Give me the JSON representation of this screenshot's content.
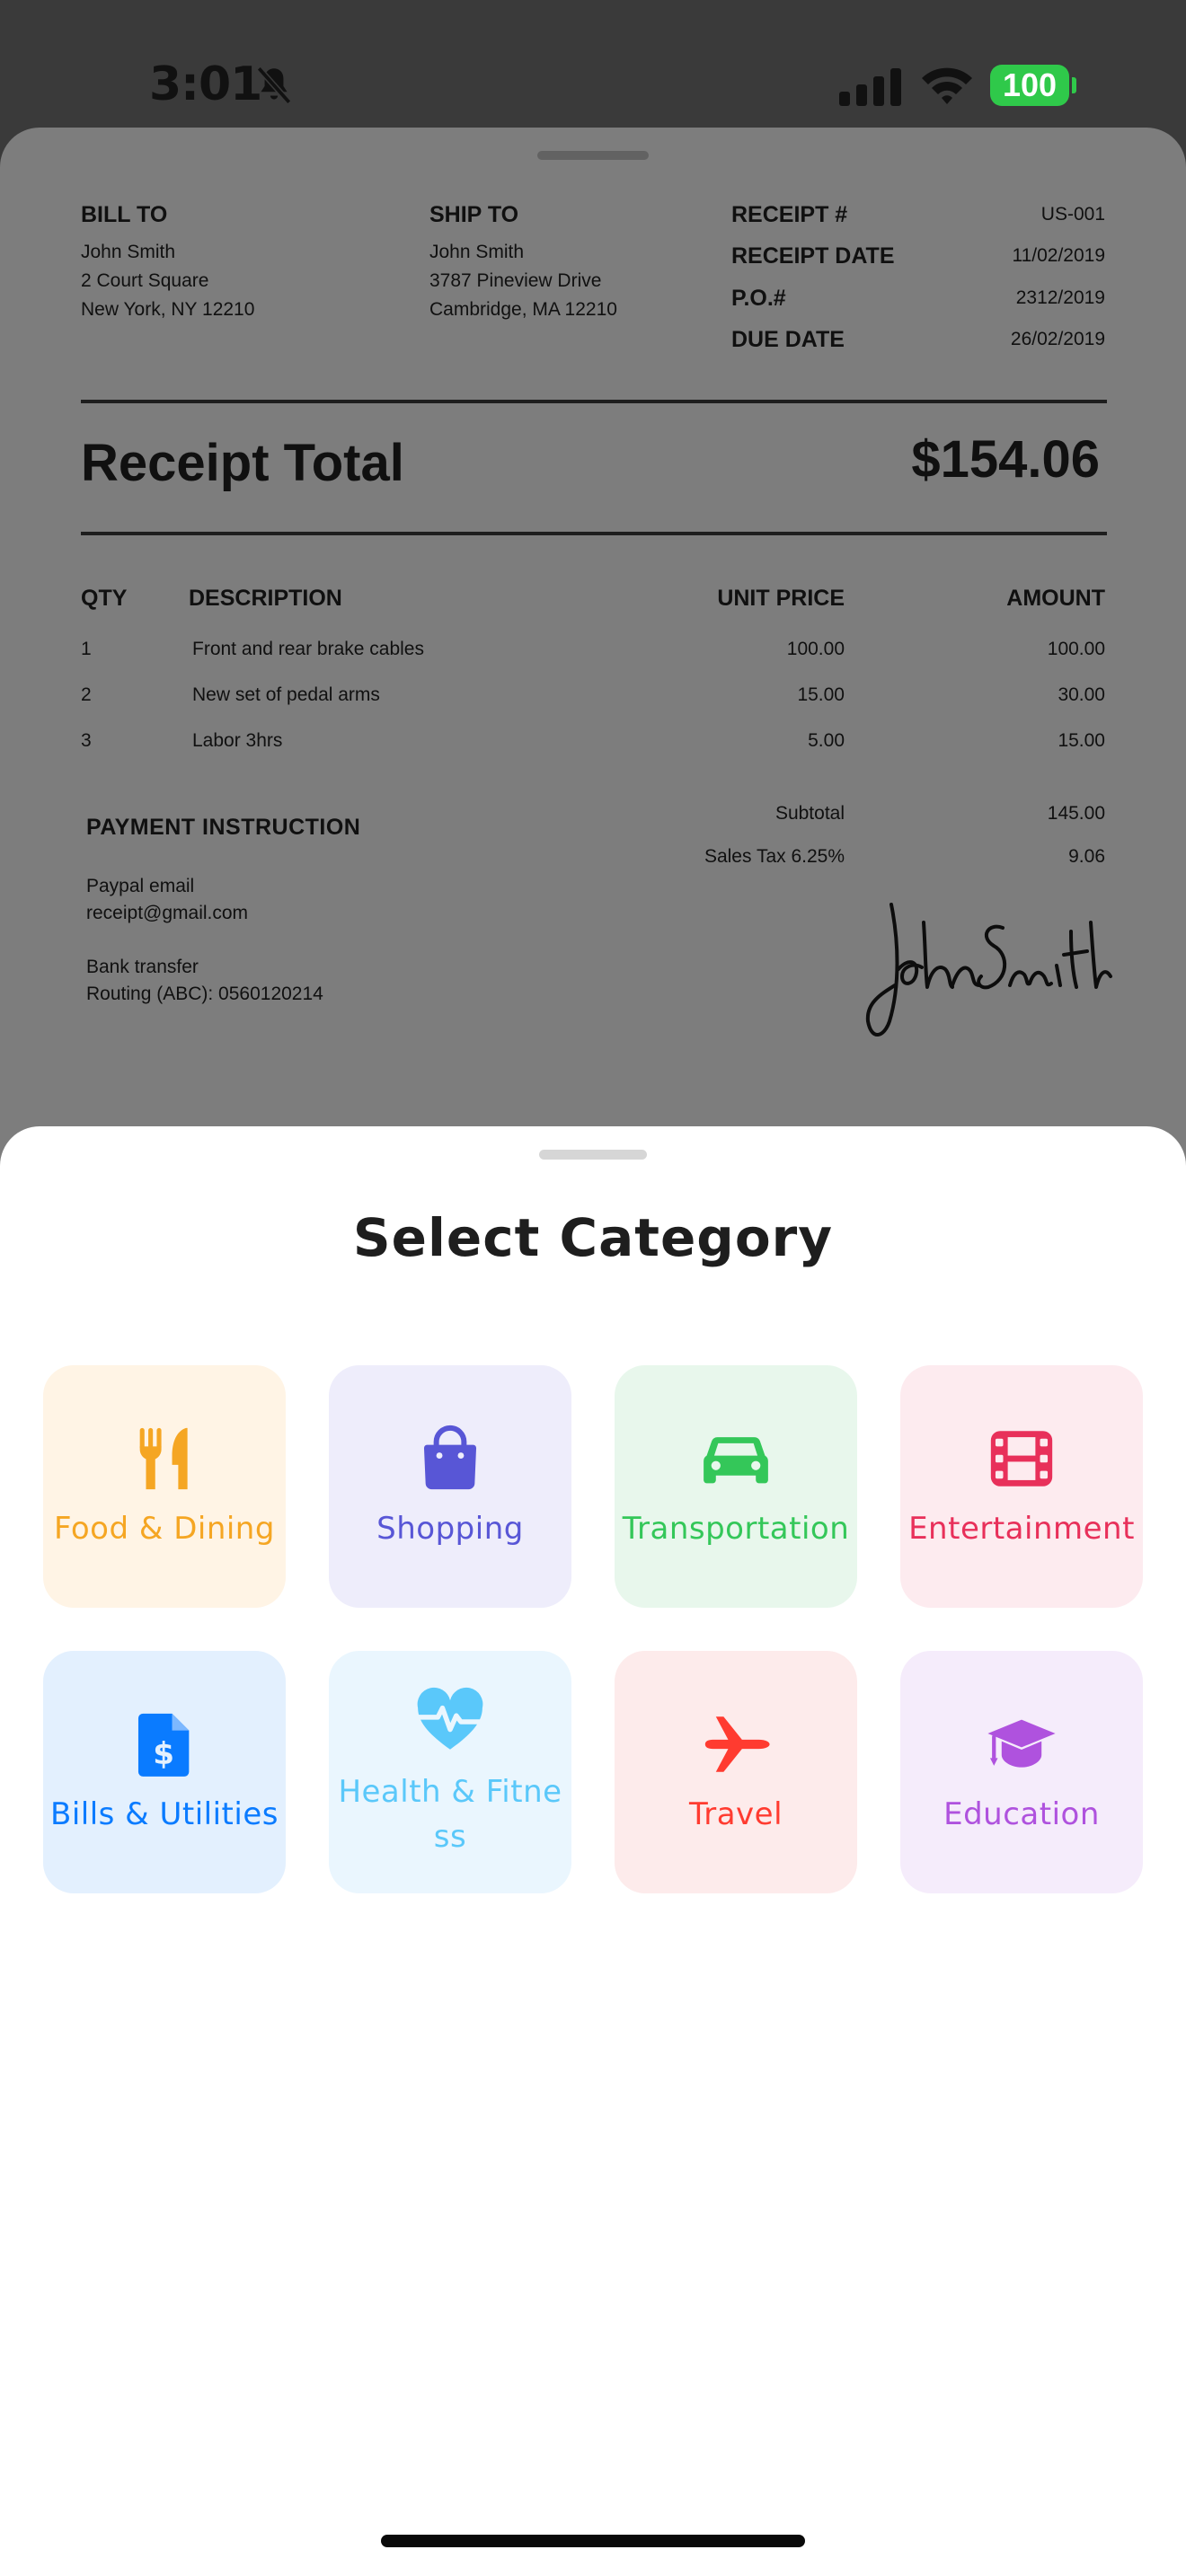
{
  "status_bar": {
    "time": "3:01",
    "battery": "100",
    "icons": [
      "bell-slash-icon",
      "cellular-signal-icon",
      "wifi-icon",
      "battery-icon"
    ]
  },
  "receipt": {
    "bill_to": {
      "label": "BILL TO",
      "name": "John Smith",
      "line1": "2 Court Square",
      "line2": "New York, NY 12210"
    },
    "ship_to": {
      "label": "SHIP TO",
      "name": "John Smith",
      "line1": "3787 Pineview Drive",
      "line2": "Cambridge, MA 12210"
    },
    "meta": [
      {
        "label": "RECEIPT #",
        "value": "US-001"
      },
      {
        "label": "RECEIPT DATE",
        "value": "11/02/2019"
      },
      {
        "label": "P.O.#",
        "value": "2312/2019"
      },
      {
        "label": "DUE DATE",
        "value": "26/02/2019"
      }
    ],
    "total_label": "Receipt Total",
    "total_value": "$154.06",
    "columns": {
      "qty": "QTY",
      "description": "DESCRIPTION",
      "unit_price": "UNIT PRICE",
      "amount": "AMOUNT"
    },
    "items": [
      {
        "qty": "1",
        "description": "Front and rear brake cables",
        "unit_price": "100.00",
        "amount": "100.00"
      },
      {
        "qty": "2",
        "description": "New set of pedal arms",
        "unit_price": "15.00",
        "amount": "30.00"
      },
      {
        "qty": "3",
        "description": "Labor 3hrs",
        "unit_price": "5.00",
        "amount": "15.00"
      }
    ],
    "payment": {
      "title": "PAYMENT INSTRUCTION",
      "paypal_label": "Paypal email",
      "paypal_value": "receipt@gmail.com",
      "bank_label": "Bank transfer",
      "bank_value": "Routing (ABC): 0560120214"
    },
    "subtotal_label": "Subtotal",
    "subtotal_value": "145.00",
    "tax_label": "Sales Tax 6.25%",
    "tax_value": "9.06",
    "signature": "John Smith"
  },
  "category_sheet": {
    "title": "Select Category",
    "categories": [
      {
        "label": "Food & Dining",
        "icon": "utensils-icon",
        "color": "#F5A623",
        "bg": "#FFF4E5"
      },
      {
        "label": "Shopping",
        "icon": "shopping-bag-icon",
        "color": "#5856D6",
        "bg": "#EEEDFB"
      },
      {
        "label": "Transportation",
        "icon": "car-icon",
        "color": "#34C759",
        "bg": "#E8F7EC"
      },
      {
        "label": "Entertainment",
        "icon": "film-icon",
        "color": "#E8305A",
        "bg": "#FDEBEF"
      },
      {
        "label": "Bills & Utilities",
        "icon": "bill-icon",
        "color": "#0A7BFF",
        "bg": "#E3F0FE"
      },
      {
        "label": "Health & Fitness",
        "icon": "heartbeat-icon",
        "color": "#5AC8FA",
        "bg": "#EAF6FE"
      },
      {
        "label": "Travel",
        "icon": "airplane-icon",
        "color": "#FF3B30",
        "bg": "#FDEBEB"
      },
      {
        "label": "Education",
        "icon": "graduation-cap-icon",
        "color": "#AF52DE",
        "bg": "#F5ECFB"
      }
    ]
  }
}
